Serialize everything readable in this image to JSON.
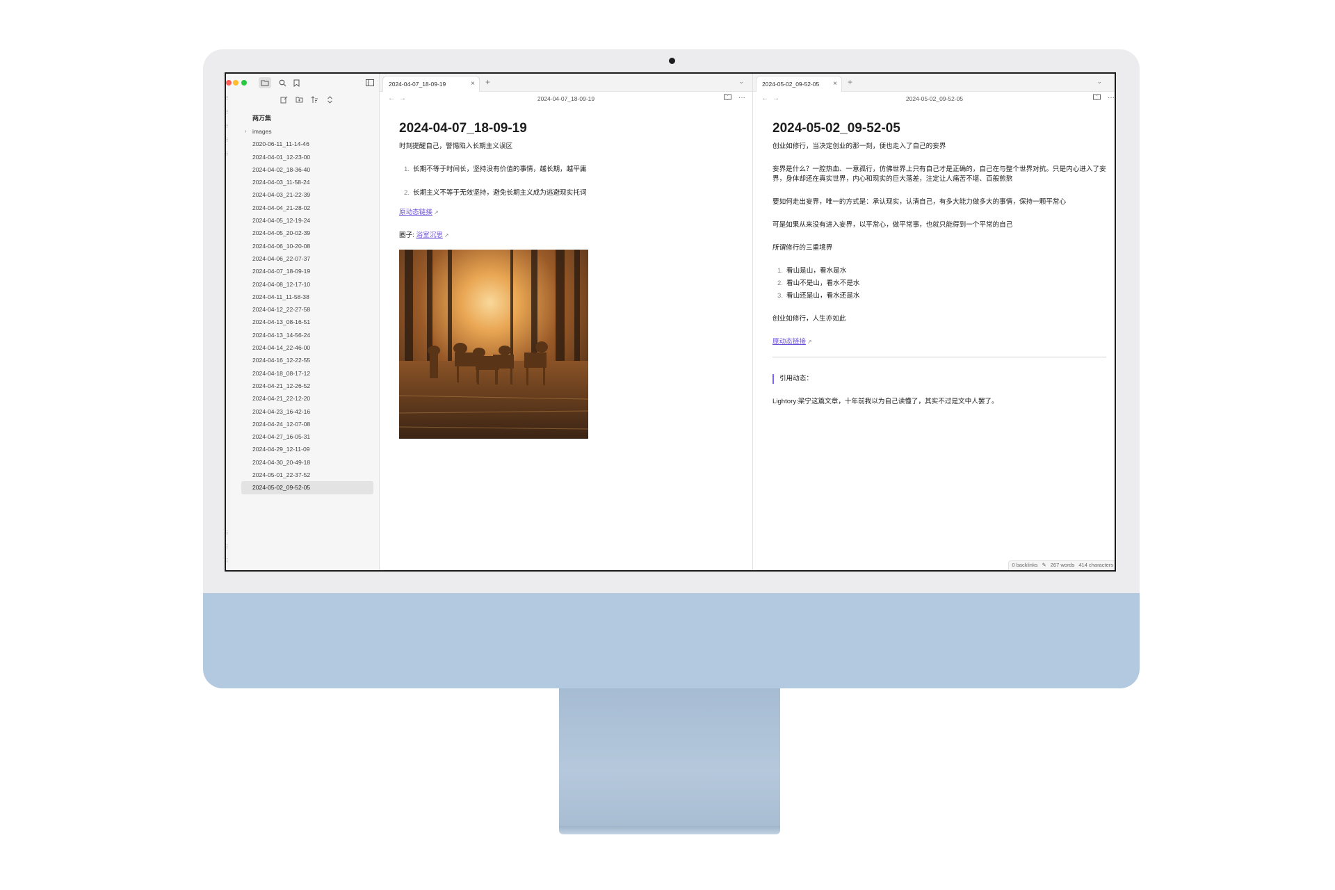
{
  "sidebar": {
    "vault_name": "两万集",
    "folder": "images",
    "files": [
      "2020-06-11_11-14-46",
      "2024-04-01_12-23-00",
      "2024-04-02_18-36-40",
      "2024-04-03_11-58-24",
      "2024-04-03_21-22-39",
      "2024-04-04_21-28-02",
      "2024-04-05_12-19-24",
      "2024-04-05_20-02-39",
      "2024-04-06_10-20-08",
      "2024-04-06_22-07-37",
      "2024-04-07_18-09-19",
      "2024-04-08_12-17-10",
      "2024-04-11_11-58-38",
      "2024-04-12_22-27-58",
      "2024-04-13_08-16-51",
      "2024-04-13_14-56-24",
      "2024-04-14_22-46-00",
      "2024-04-16_12-22-55",
      "2024-04-18_08-17-12",
      "2024-04-21_12-26-52",
      "2024-04-21_22-12-20",
      "2024-04-23_16-42-16",
      "2024-04-24_12-07-08",
      "2024-04-27_16-05-31",
      "2024-04-29_12-11-09",
      "2024-04-30_20-49-18",
      "2024-05-01_22-37-52",
      "2024-05-02_09-52-05"
    ],
    "active_file": "2024-05-02_09-52-05"
  },
  "left_pane": {
    "tab_label": "2024-04-07_18-09-19",
    "nav_title": "2024-04-07_18-09-19",
    "title": "2024-04-07_18-09-19",
    "intro": "时刻提醒自己，警惕陷入长期主义误区",
    "list": [
      {
        "num": "1.",
        "text": "长期不等于时间长，坚持没有价值的事情，越长期，越平庸"
      },
      {
        "num": "2.",
        "text": "长期主义不等于无效坚持，避免长期主义成为逃避现实托词"
      }
    ],
    "link_text": "原动态链接",
    "circle_label": "圈子: ",
    "circle_link": "浴室沉思"
  },
  "right_pane": {
    "tab_label": "2024-05-02_09-52-05",
    "nav_title": "2024-05-02_09-52-05",
    "title": "2024-05-02_09-52-05",
    "p1": "创业如修行，当决定创业的那一刻，便也走入了自己的妄界",
    "p2": "妄界是什么？一腔热血、一意孤行，仿佛世界上只有自己才是正确的，自己在与整个世界对抗。只是内心进入了妄界，身体却还在真实世界，内心和现实的巨大落差，注定让人痛苦不堪、百般煎熬",
    "p3": "要如何走出妄界，唯一的方式是：承认现实，认清自己，有多大能力做多大的事情，保持一颗平常心",
    "p4": "可是如果从来没有进入妄界，以平常心，做平常事，也就只能得到一个平常的自己",
    "p5": "所谓修行的三重境界",
    "list": [
      {
        "num": "1.",
        "text": "看山是山，看水是水"
      },
      {
        "num": "2.",
        "text": "看山不是山，看水不是水"
      },
      {
        "num": "3.",
        "text": "看山还是山，看水还是水"
      }
    ],
    "p6": "创业如修行，人生亦如此",
    "link_text": "原动态链接",
    "quote": "引用动态：",
    "p7": "Lightory:梁宁这篇文章，十年前我以为自己读懂了，其实不过是文中人罢了。"
  },
  "status_bar": {
    "backlinks": "0 backlinks",
    "words": "267 words",
    "chars": "414 characters"
  },
  "colors": {
    "accent_link": "#6a4fd8",
    "quote_bar": "#7b61ff",
    "imac_chin": "#b3c9df"
  }
}
